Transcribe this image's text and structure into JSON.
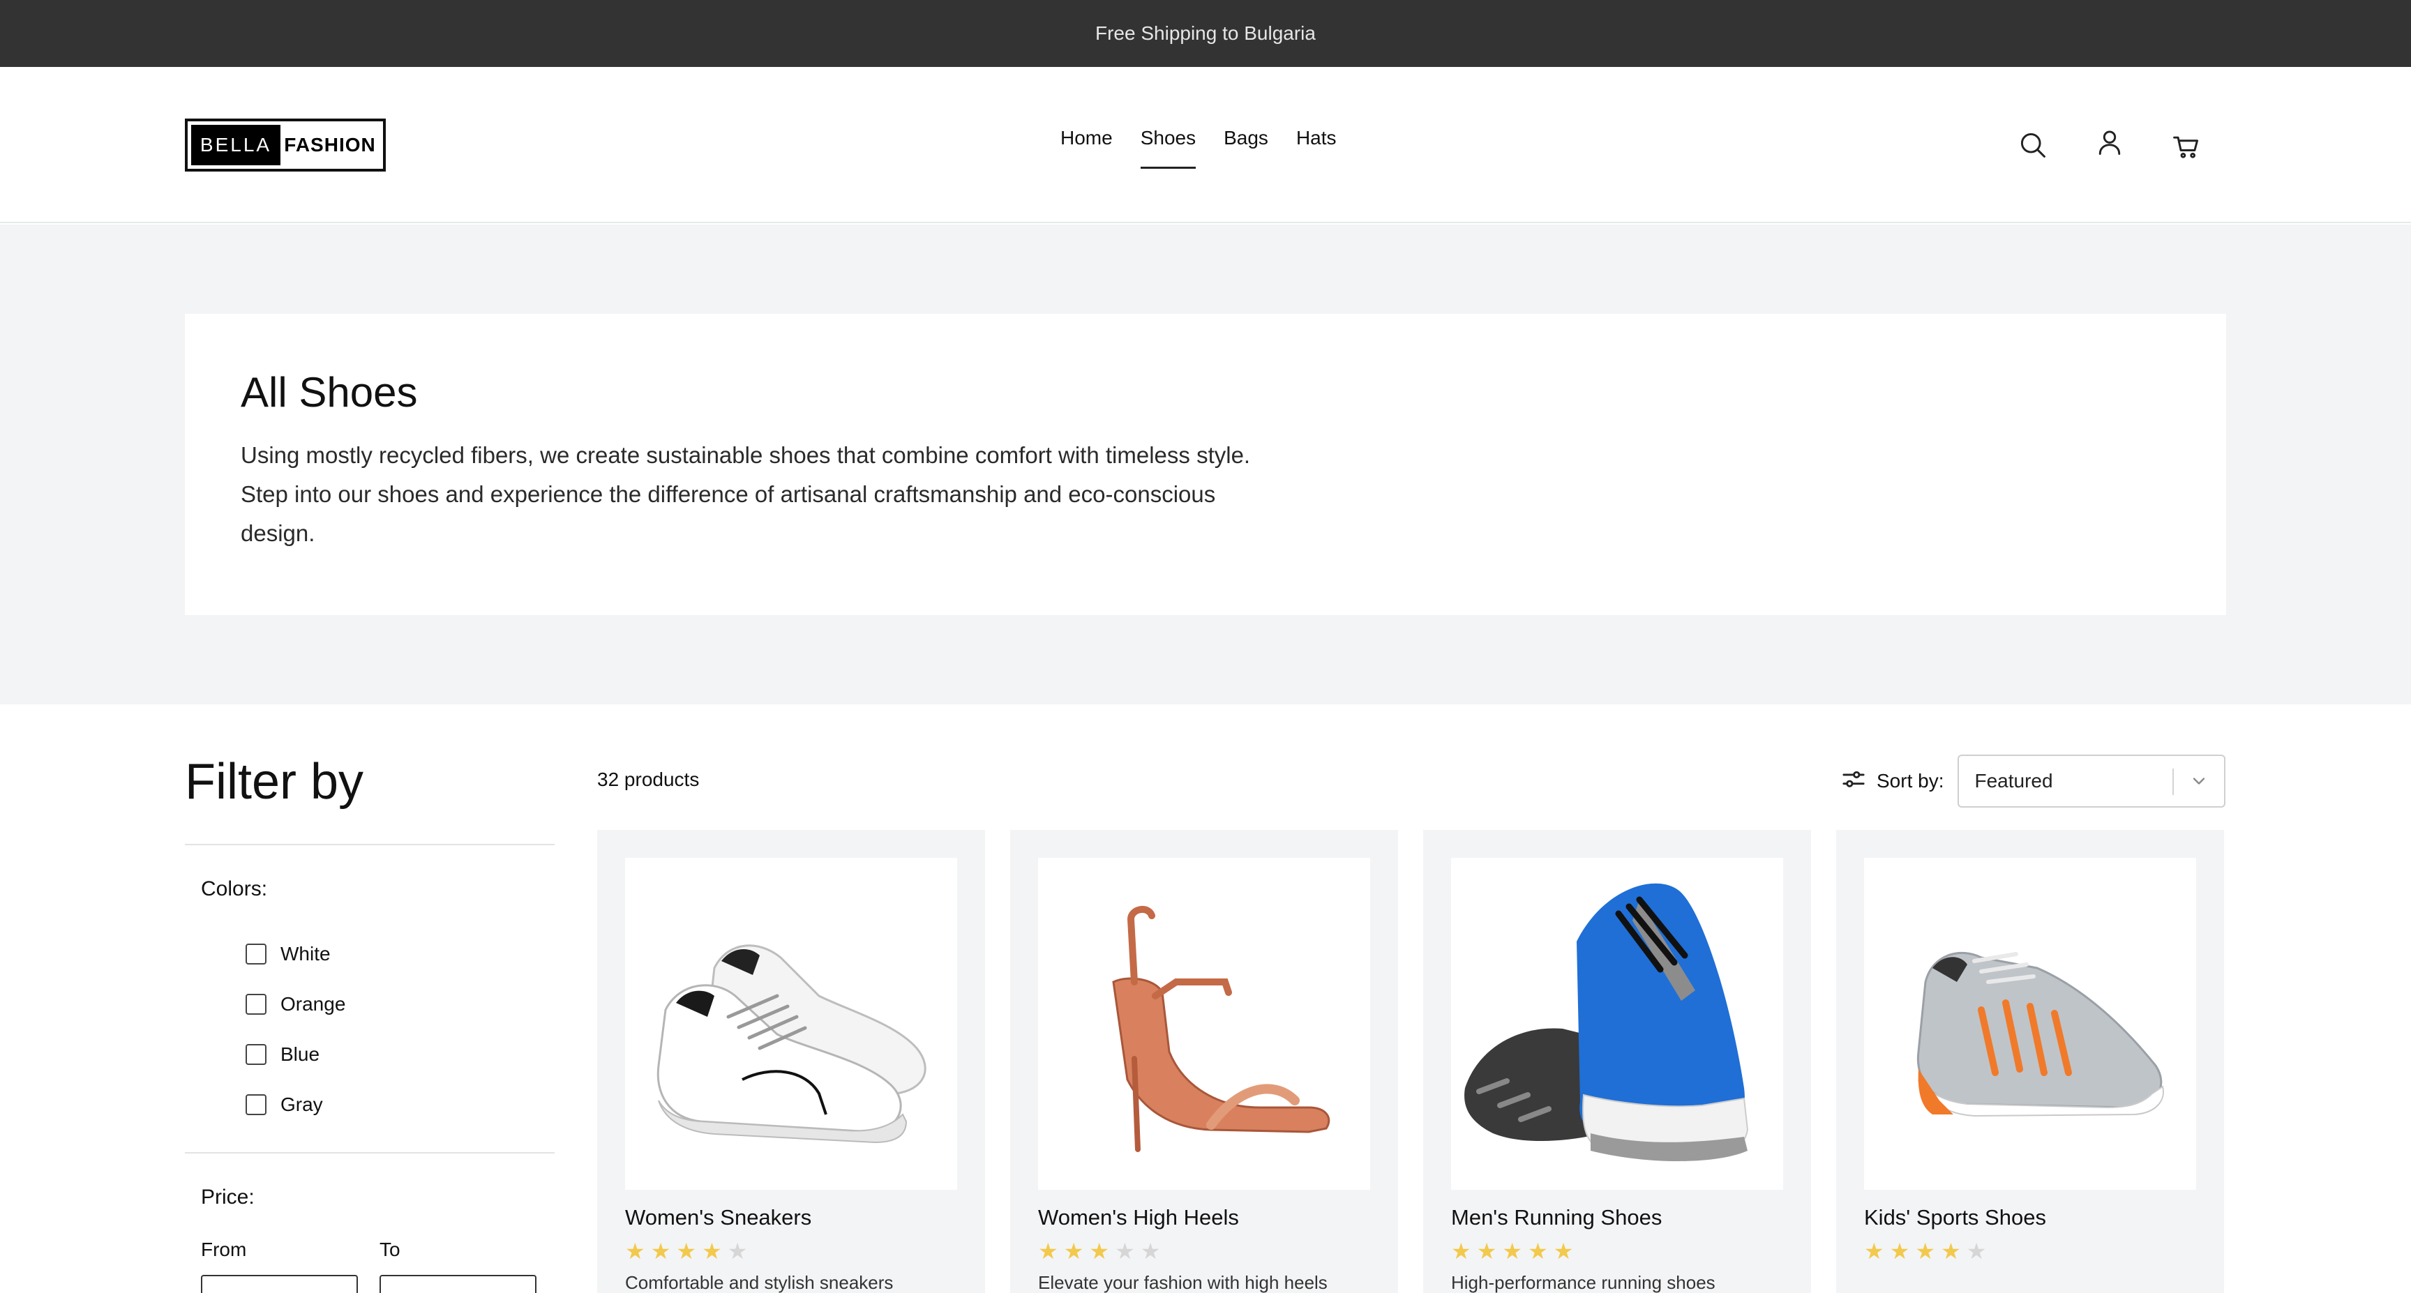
{
  "announcement": {
    "text": "Free Shipping to Bulgaria"
  },
  "header": {
    "logo": {
      "left": "BELLA",
      "right": "FASHION"
    },
    "nav": [
      {
        "label": "Home",
        "active": false
      },
      {
        "label": "Shoes",
        "active": true
      },
      {
        "label": "Bags",
        "active": false
      },
      {
        "label": "Hats",
        "active": false
      }
    ],
    "icons": [
      "search-icon",
      "account-icon",
      "cart-icon"
    ]
  },
  "hero": {
    "title": "All Shoes",
    "description": "Using mostly recycled fibers, we create sustainable shoes that combine comfort with timeless style. Step into our shoes and experience the difference of artisanal craftsmanship and eco-conscious design."
  },
  "filters": {
    "title": "Filter by",
    "colors_heading": "Colors:",
    "colors": [
      {
        "label": "White",
        "checked": false
      },
      {
        "label": "Orange",
        "checked": false
      },
      {
        "label": "Blue",
        "checked": false
      },
      {
        "label": "Gray",
        "checked": false
      }
    ],
    "price_heading": "Price:",
    "price_from_label": "From",
    "price_to_label": "To"
  },
  "listing": {
    "count_text": "32 products",
    "sort_label": "Sort by:",
    "sort_value": "Featured",
    "products": [
      {
        "name": "Women's Sneakers",
        "rating": 4,
        "desc": "Comfortable and stylish sneakers"
      },
      {
        "name": "Women's High Heels",
        "rating": 3,
        "desc": "Elevate your fashion with high heels"
      },
      {
        "name": "Men's Running Shoes",
        "rating": 5,
        "desc": "High-performance running shoes"
      },
      {
        "name": "Kids' Sports Shoes",
        "rating": 4,
        "desc": ""
      }
    ]
  },
  "colors": {
    "announcement_bg": "#333333",
    "hero_bg": "#f3f4f6",
    "star": "#f2c94c",
    "accent_blue": "#1f6fd6",
    "accent_orange": "#f07a2a"
  }
}
